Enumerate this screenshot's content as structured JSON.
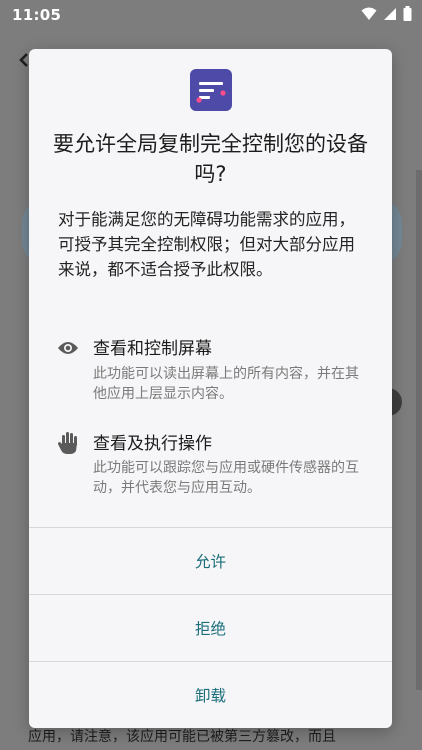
{
  "status_bar": {
    "time": "11:05",
    "icons": [
      "wifi-icon",
      "signal-icon",
      "battery-icon"
    ]
  },
  "background": {
    "footer_text": "应用，请注意，该应用可能已被第三方篡改，而且"
  },
  "dialog": {
    "icon": "app-icon",
    "title": "要允许全局复制完全控制您的设备吗?",
    "description": "对于能满足您的无障碍功能需求的应用，可授予其完全控制权限；但对大部分应用来说，都不适合授予此权限。",
    "permissions": [
      {
        "icon": "eye-icon",
        "title": "查看和控制屏幕",
        "subtitle": "此功能可以读出屏幕上的所有内容，并在其他应用上层显示内容。"
      },
      {
        "icon": "hand-icon",
        "title": "查看及执行操作",
        "subtitle": "此功能可以跟踪您与应用或硬件传感器的互动，并代表您与应用互动。"
      }
    ],
    "actions": {
      "allow": "允许",
      "deny": "拒绝",
      "uninstall": "卸载"
    }
  },
  "colors": {
    "scrim": "#7d7d7d",
    "dialog_bg": "#f6f6f8",
    "action_text": "#1a6e7a",
    "icon_bg": "#4d4aa8"
  }
}
